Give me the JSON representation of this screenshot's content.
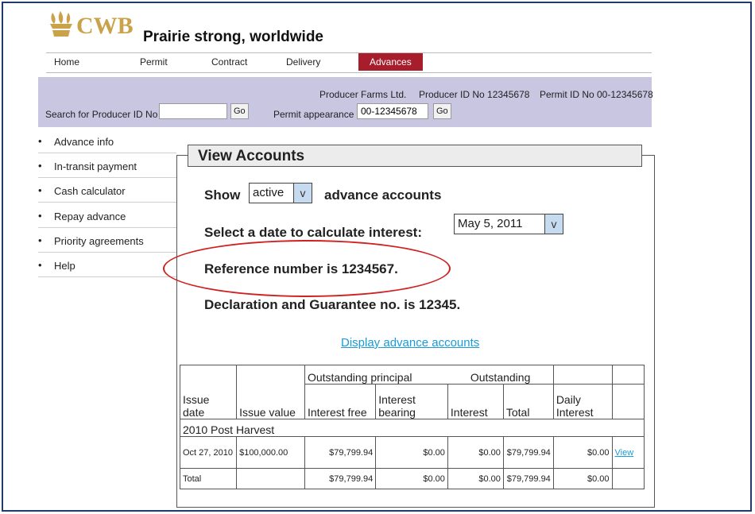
{
  "brand": {
    "logo_text": "CWB",
    "tagline": "Prairie strong, worldwide"
  },
  "nav": [
    {
      "label": "Home",
      "active": false
    },
    {
      "label": "Permit",
      "active": false
    },
    {
      "label": "Contract",
      "active": false
    },
    {
      "label": "Delivery",
      "active": false
    },
    {
      "label": "Advances",
      "active": true
    }
  ],
  "producer_bar": {
    "farm_name": "Producer Farms Ltd.",
    "producer_id": "Producer ID No 12345678",
    "permit_id": "Permit ID No 00-12345678",
    "search_label": "Search for Producer ID No",
    "search_value": "",
    "go_label": "Go",
    "permit_appearance_label": "Permit appearance",
    "permit_appearance_value": "00-12345678",
    "go2_label": "Go"
  },
  "sidebar": {
    "bullet": "•",
    "items": [
      {
        "label": "Advance info"
      },
      {
        "label": "In-transit payment"
      },
      {
        "label": "Cash calculator"
      },
      {
        "label": "Repay advance"
      },
      {
        "label": "Priority agreements"
      },
      {
        "label": "Help"
      }
    ]
  },
  "main": {
    "title": "View Accounts",
    "show_label": "Show",
    "show_value": "active",
    "show_suffix": "advance accounts",
    "date_label": "Select a date to calculate interest:",
    "date_value": "May 5, 2011",
    "dropdown_arrow": "v",
    "reference_text": "Reference number is 1234567.",
    "declaration_text": "Declaration and Guarantee no. is 12345.",
    "display_link": "Display advance accounts"
  },
  "table": {
    "group_headers": {
      "outstanding_principal": "Outstanding principal",
      "outstanding": "Outstanding"
    },
    "columns": {
      "issue_date": "Issue date",
      "issue_value": "Issue value",
      "interest_free": "Interest free",
      "interest_bearing": "Interest bearing",
      "interest": "Interest",
      "total": "Total",
      "daily_interest": "Daily Interest"
    },
    "section_label": "2010 Post Harvest",
    "row": {
      "issue_date": "Oct 27, 2010",
      "issue_value": "$100,000.00",
      "interest_free": "$79,799.94",
      "interest_bearing": "$0.00",
      "interest": "$0.00",
      "total": "$79,799.94",
      "daily_interest": "$0.00",
      "action": "View"
    },
    "total_row": {
      "label": "Total",
      "interest_free": "$79,799.94",
      "interest_bearing": "$0.00",
      "interest": "$0.00",
      "total": "$79,799.94",
      "daily_interest": "$0.00"
    }
  },
  "colors": {
    "brand_gold": "#c9a24a",
    "nav_active": "#a81d2b",
    "producer_bar": "#c9c6e2",
    "link": "#1a9ad6",
    "highlight": "#d02020",
    "frame": "#1f3a6b"
  }
}
